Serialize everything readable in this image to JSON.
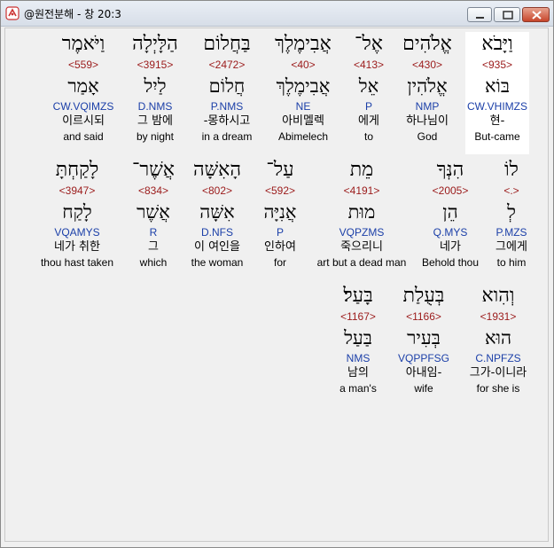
{
  "window": {
    "title": "@원전분해 - 창 20:3",
    "icon": "app-logo-icon",
    "controls": [
      "minimize-icon",
      "maximize-icon",
      "close-icon"
    ]
  },
  "lines": [
    {
      "words": [
        {
          "hebrew": "וַיָּבֹא",
          "ref": "<935>",
          "lemma": "בּוֹא",
          "morph": "CW.VHIMZS",
          "korean": "현-",
          "english": "But-came",
          "selected": true
        },
        {
          "hebrew": "אֱלֹהִים",
          "ref": "<430>",
          "lemma": "אֱלֹהִין",
          "morph": "NMP",
          "korean": "하나님이",
          "english": "God"
        },
        {
          "hebrew": "אֶל־",
          "ref": "<413>",
          "lemma": "אֵל",
          "morph": "P",
          "korean": "에게",
          "english": "to"
        },
        {
          "hebrew": "אֲבִימֶלֶךְ",
          "ref": "<40>",
          "lemma": "אֲבִימֶלֶךְ",
          "morph": "NE",
          "korean": "아비멜렉",
          "english": "Abimelech"
        },
        {
          "hebrew": "בַּחֲלוֹם",
          "ref": "<2472>",
          "lemma": "חֲלוֹם",
          "morph": "P.NMS",
          "korean": "-몽하시고",
          "english": "in a dream"
        },
        {
          "hebrew": "הַלָּיְלָה",
          "ref": "<3915>",
          "lemma": "לַיִל",
          "morph": "D.NMS",
          "korean": "그 밤에",
          "english": "by night"
        },
        {
          "hebrew": "וַיֹּאמֶר",
          "ref": "<559>",
          "lemma": "אָמַר",
          "morph": "CW.VQIMZS",
          "korean": "이르시되",
          "english": "and said"
        }
      ]
    },
    {
      "words": [
        {
          "hebrew": "לוֹ",
          "ref": "<.>",
          "lemma": "לְ",
          "morph": "P.MZS",
          "korean": "그에게",
          "english": "to him"
        },
        {
          "hebrew": "הִנְּךָ",
          "ref": "<2005>",
          "lemma": "הֵן",
          "morph": "Q.MYS",
          "korean": "네가",
          "english": "Behold thou"
        },
        {
          "hebrew": "מֵת",
          "ref": "<4191>",
          "lemma": "מוּת",
          "morph": "VQPZMS",
          "korean": "죽으리니",
          "english": "art but a dead man"
        },
        {
          "hebrew": "עַל־",
          "ref": "<592>",
          "lemma": "אֲנִיָּה",
          "morph": "P",
          "korean": "인하여",
          "english": "for"
        },
        {
          "hebrew": "הָאִשָּׁה",
          "ref": "<802>",
          "lemma": "אִשָּׁה",
          "morph": "D.NFS",
          "korean": "이 여인을",
          "english": "the woman"
        },
        {
          "hebrew": "אֲשֶׁר־",
          "ref": "<834>",
          "lemma": "אֲשֶׁר",
          "morph": "R",
          "korean": "그",
          "english": "which"
        },
        {
          "hebrew": "לָקַחְתָּ",
          "ref": "<3947>",
          "lemma": "לָקַח",
          "morph": "VQAMYS",
          "korean": "네가 취한",
          "english": "thou hast taken"
        }
      ]
    },
    {
      "words": [
        {
          "hebrew": "וְהִוא",
          "ref": "<1931>",
          "lemma": "הוּא",
          "morph": "C.NPFZS",
          "korean": "그가-이니라",
          "english": "for she is"
        },
        {
          "hebrew": "בְּעֻלַת",
          "ref": "<1166>",
          "lemma": "בְּעִיר",
          "morph": "VQPPFSG",
          "korean": "아내임-",
          "english": "wife"
        },
        {
          "hebrew": "בָּעַל׃",
          "ref": "<1167>",
          "lemma": "בַּעַל",
          "morph": "NMS",
          "korean": "남의",
          "english": "a man's"
        }
      ]
    }
  ]
}
